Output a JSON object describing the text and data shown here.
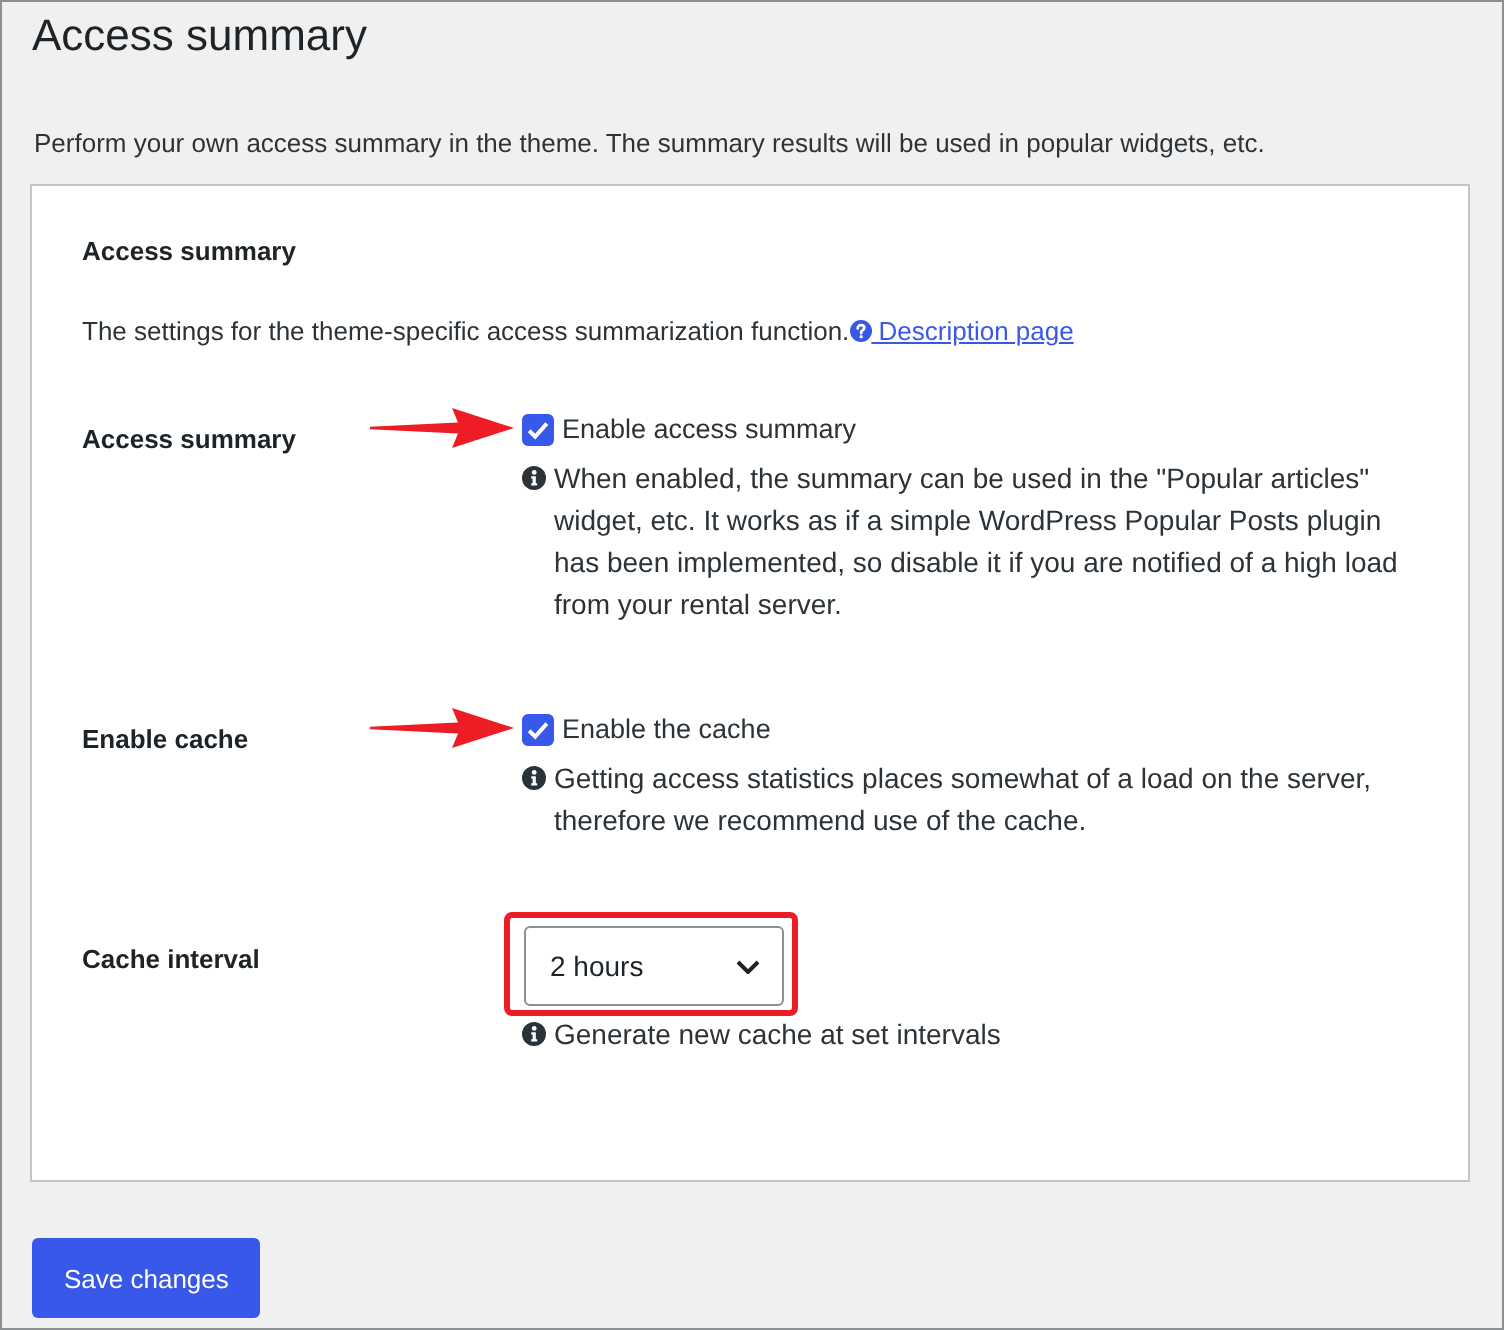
{
  "page": {
    "title": "Access summary",
    "description": "Perform your own access summary in the theme. The summary results will be used in popular widgets, etc."
  },
  "section": {
    "title": "Access summary",
    "description": "The settings for the theme-specific access summarization function.",
    "link": {
      "label": "Description page"
    }
  },
  "settings": [
    {
      "kind": "checkbox",
      "label": "Access summary",
      "option": "Enable access summary",
      "checked": true,
      "arrow": true,
      "help": "When enabled, the summary can be used in the \"Popular articles\" widget, etc. It works as if a simple WordPress Popular Posts plugin has been implemented, so disable it if you are notified of a high load from your rental server."
    },
    {
      "kind": "checkbox",
      "label": "Enable cache",
      "option": "Enable the cache",
      "checked": true,
      "arrow": true,
      "help": "Getting access statistics places somewhat of a load on the server, therefore we recommend use of the cache."
    },
    {
      "kind": "select",
      "label": "Cache interval",
      "value": "2 hours",
      "highlight_frame": true,
      "help": "Generate new cache at set intervals"
    }
  ],
  "save_button": {
    "label": "Save changes"
  }
}
